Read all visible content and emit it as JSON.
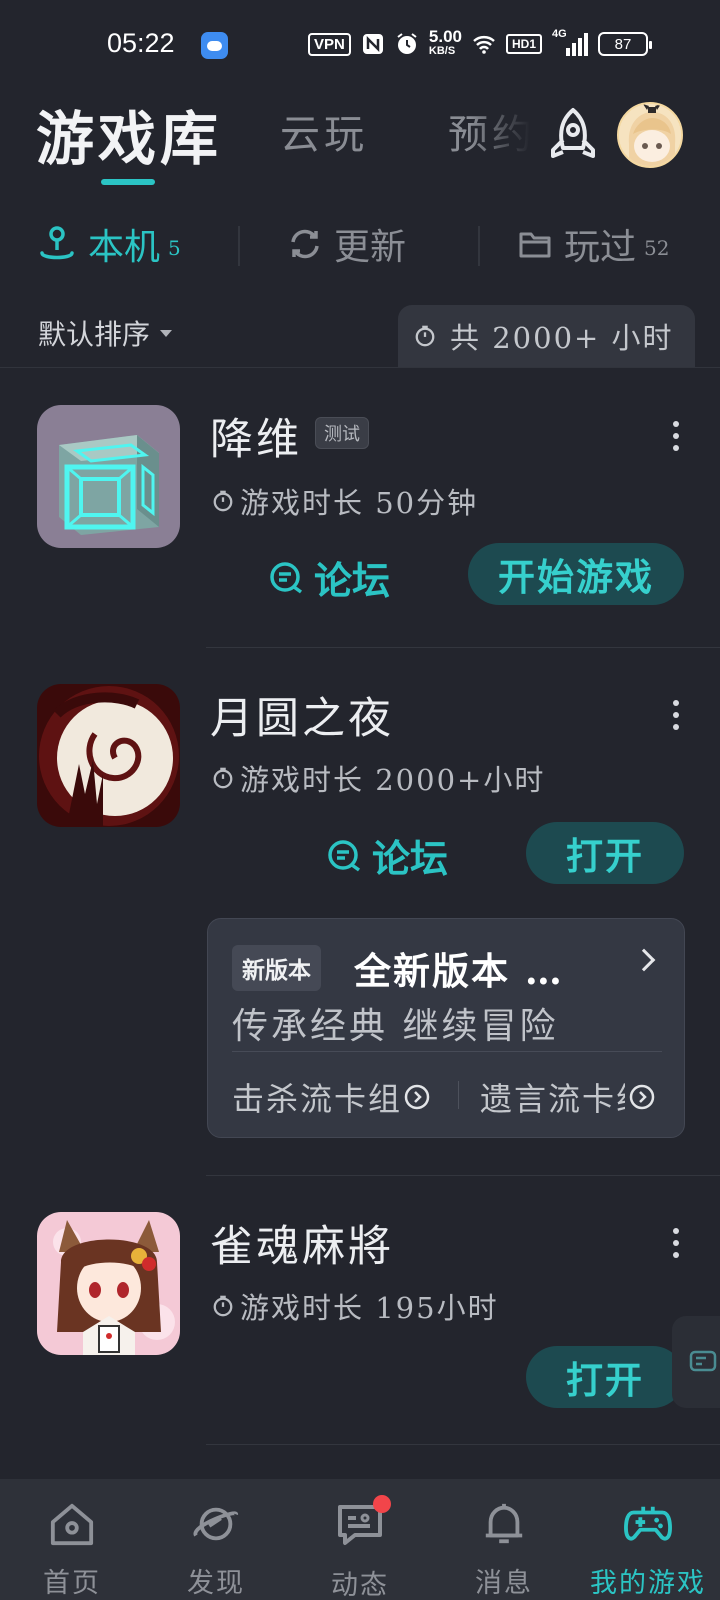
{
  "status_bar": {
    "time": "05:22",
    "vpn": "VPN",
    "speed_value": "5.00",
    "speed_unit": "KB/S",
    "hd": "HD1",
    "network": "4G",
    "battery": "87"
  },
  "header": {
    "tabs": [
      {
        "label": "游戏库"
      },
      {
        "label": "云玩"
      },
      {
        "label": "预约"
      }
    ]
  },
  "subtabs": [
    {
      "label": "本机",
      "count": "5"
    },
    {
      "label": "更新",
      "count": ""
    },
    {
      "label": "玩过",
      "count": "52"
    }
  ],
  "sort": {
    "label": "默认排序"
  },
  "total_playtime": "共 2000+ 小时",
  "games": [
    {
      "name": "降维",
      "tag": "测试",
      "playtime": "游戏时长 50分钟",
      "forum": "论坛",
      "action": "开始游戏"
    },
    {
      "name": "月圆之夜",
      "tag": "",
      "playtime": "游戏时长 2000+小时",
      "forum": "论坛",
      "action": "打开"
    },
    {
      "name": "雀魂麻將",
      "tag": "",
      "playtime": "游戏时长 195小时",
      "forum": "",
      "action": "打开"
    }
  ],
  "update_card": {
    "badge": "新版本",
    "title": "全新版本 …",
    "subtitle": "传承经典 继续冒险",
    "links": [
      {
        "label": "击杀流卡组"
      },
      {
        "label": "遗言流卡组"
      }
    ]
  },
  "bottom_nav": [
    {
      "label": "首页",
      "icon": "home-icon"
    },
    {
      "label": "发现",
      "icon": "planet-icon"
    },
    {
      "label": "动态",
      "icon": "message-icon"
    },
    {
      "label": "消息",
      "icon": "bell-icon"
    },
    {
      "label": "我的游戏",
      "icon": "gamepad-icon"
    }
  ],
  "colors": {
    "accent": "#2bc4c4",
    "background": "#23252d",
    "button_bg": "#1d4a50",
    "badge_red": "#f2454a"
  }
}
